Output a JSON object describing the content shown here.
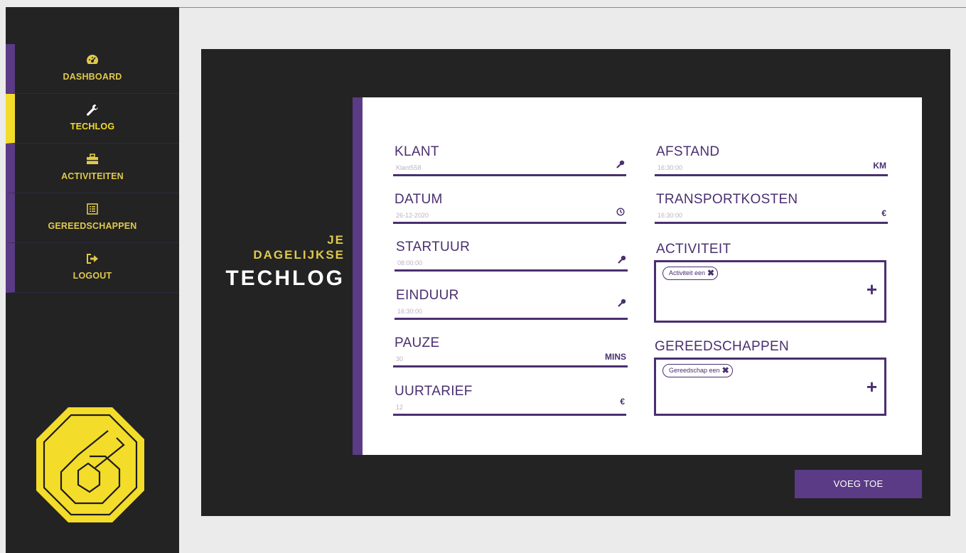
{
  "sidebar": {
    "items": [
      {
        "label": "DASHBOARD",
        "icon": "dashboard-gauge-icon"
      },
      {
        "label": "TECHLOG",
        "icon": "wrench-icon"
      },
      {
        "label": "ACTIVITEITEN",
        "icon": "toolbox-icon"
      },
      {
        "label": "GEREEDSCHAPPEN",
        "icon": "list-icon"
      },
      {
        "label": "LOGOUT",
        "icon": "logout-icon"
      }
    ],
    "active": "TECHLOG"
  },
  "heading": {
    "line1": "JE",
    "line2": "DAGELIJKSE",
    "line3": "TECHLOG"
  },
  "form": {
    "klant": {
      "label": "KLANT",
      "value": "Klant558",
      "icon": "key-icon"
    },
    "datum": {
      "label": "DATUM",
      "value": "26-12-2020",
      "icon": "clock-icon"
    },
    "startuur": {
      "label": "STARTUUR",
      "value": "08:00:00",
      "icon": "key-icon"
    },
    "einduur": {
      "label": "EINDUUR",
      "value": "16:30:00",
      "icon": "key-icon"
    },
    "pauze": {
      "label": "PAUZE",
      "value": "30",
      "suffix": "MINS"
    },
    "uurtarief": {
      "label": "UURTARIEF",
      "value": "12",
      "suffix": "€"
    },
    "afstand": {
      "label": "AFSTAND",
      "value": "16:30:00",
      "suffix": "KM"
    },
    "transportkosten": {
      "label": "TRANSPORTKOSTEN",
      "value": "16:30:00",
      "suffix": "€"
    },
    "activiteit": {
      "label": "ACTIVITEIT",
      "chip": "Activiteit een",
      "add": "+"
    },
    "gereedschappen": {
      "label": "GEREEDSCHAPPEN",
      "chip": "Gereedschap een",
      "add": "+"
    }
  },
  "submit_label": "VOEG TOE",
  "colors": {
    "accent": "#5b3b85",
    "highlight": "#f4dc2a",
    "dark": "#232323"
  }
}
